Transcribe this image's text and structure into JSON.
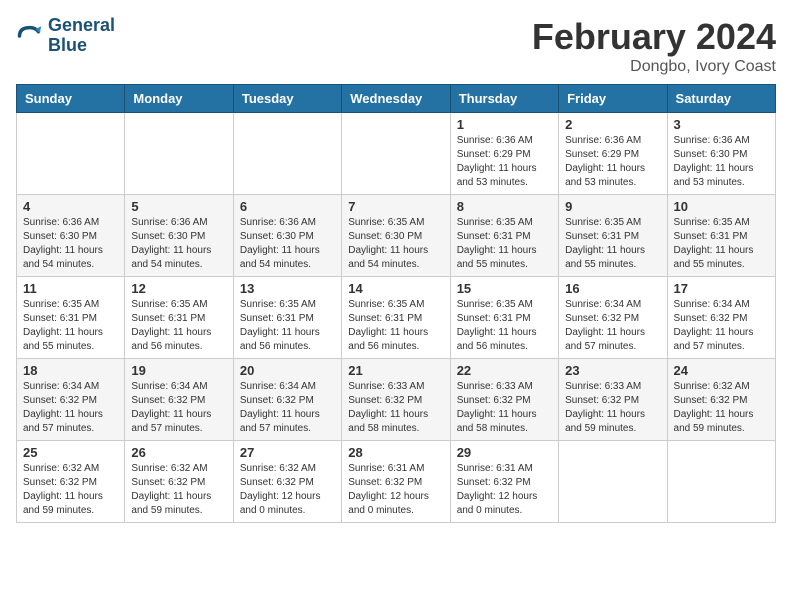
{
  "header": {
    "logo_line1": "General",
    "logo_line2": "Blue",
    "month": "February 2024",
    "location": "Dongbo, Ivory Coast"
  },
  "weekdays": [
    "Sunday",
    "Monday",
    "Tuesday",
    "Wednesday",
    "Thursday",
    "Friday",
    "Saturday"
  ],
  "weeks": [
    [
      {
        "day": "",
        "info": ""
      },
      {
        "day": "",
        "info": ""
      },
      {
        "day": "",
        "info": ""
      },
      {
        "day": "",
        "info": ""
      },
      {
        "day": "1",
        "info": "Sunrise: 6:36 AM\nSunset: 6:29 PM\nDaylight: 11 hours\nand 53 minutes."
      },
      {
        "day": "2",
        "info": "Sunrise: 6:36 AM\nSunset: 6:29 PM\nDaylight: 11 hours\nand 53 minutes."
      },
      {
        "day": "3",
        "info": "Sunrise: 6:36 AM\nSunset: 6:30 PM\nDaylight: 11 hours\nand 53 minutes."
      }
    ],
    [
      {
        "day": "4",
        "info": "Sunrise: 6:36 AM\nSunset: 6:30 PM\nDaylight: 11 hours\nand 54 minutes."
      },
      {
        "day": "5",
        "info": "Sunrise: 6:36 AM\nSunset: 6:30 PM\nDaylight: 11 hours\nand 54 minutes."
      },
      {
        "day": "6",
        "info": "Sunrise: 6:36 AM\nSunset: 6:30 PM\nDaylight: 11 hours\nand 54 minutes."
      },
      {
        "day": "7",
        "info": "Sunrise: 6:35 AM\nSunset: 6:30 PM\nDaylight: 11 hours\nand 54 minutes."
      },
      {
        "day": "8",
        "info": "Sunrise: 6:35 AM\nSunset: 6:31 PM\nDaylight: 11 hours\nand 55 minutes."
      },
      {
        "day": "9",
        "info": "Sunrise: 6:35 AM\nSunset: 6:31 PM\nDaylight: 11 hours\nand 55 minutes."
      },
      {
        "day": "10",
        "info": "Sunrise: 6:35 AM\nSunset: 6:31 PM\nDaylight: 11 hours\nand 55 minutes."
      }
    ],
    [
      {
        "day": "11",
        "info": "Sunrise: 6:35 AM\nSunset: 6:31 PM\nDaylight: 11 hours\nand 55 minutes."
      },
      {
        "day": "12",
        "info": "Sunrise: 6:35 AM\nSunset: 6:31 PM\nDaylight: 11 hours\nand 56 minutes."
      },
      {
        "day": "13",
        "info": "Sunrise: 6:35 AM\nSunset: 6:31 PM\nDaylight: 11 hours\nand 56 minutes."
      },
      {
        "day": "14",
        "info": "Sunrise: 6:35 AM\nSunset: 6:31 PM\nDaylight: 11 hours\nand 56 minutes."
      },
      {
        "day": "15",
        "info": "Sunrise: 6:35 AM\nSunset: 6:31 PM\nDaylight: 11 hours\nand 56 minutes."
      },
      {
        "day": "16",
        "info": "Sunrise: 6:34 AM\nSunset: 6:32 PM\nDaylight: 11 hours\nand 57 minutes."
      },
      {
        "day": "17",
        "info": "Sunrise: 6:34 AM\nSunset: 6:32 PM\nDaylight: 11 hours\nand 57 minutes."
      }
    ],
    [
      {
        "day": "18",
        "info": "Sunrise: 6:34 AM\nSunset: 6:32 PM\nDaylight: 11 hours\nand 57 minutes."
      },
      {
        "day": "19",
        "info": "Sunrise: 6:34 AM\nSunset: 6:32 PM\nDaylight: 11 hours\nand 57 minutes."
      },
      {
        "day": "20",
        "info": "Sunrise: 6:34 AM\nSunset: 6:32 PM\nDaylight: 11 hours\nand 57 minutes."
      },
      {
        "day": "21",
        "info": "Sunrise: 6:33 AM\nSunset: 6:32 PM\nDaylight: 11 hours\nand 58 minutes."
      },
      {
        "day": "22",
        "info": "Sunrise: 6:33 AM\nSunset: 6:32 PM\nDaylight: 11 hours\nand 58 minutes."
      },
      {
        "day": "23",
        "info": "Sunrise: 6:33 AM\nSunset: 6:32 PM\nDaylight: 11 hours\nand 59 minutes."
      },
      {
        "day": "24",
        "info": "Sunrise: 6:32 AM\nSunset: 6:32 PM\nDaylight: 11 hours\nand 59 minutes."
      }
    ],
    [
      {
        "day": "25",
        "info": "Sunrise: 6:32 AM\nSunset: 6:32 PM\nDaylight: 11 hours\nand 59 minutes."
      },
      {
        "day": "26",
        "info": "Sunrise: 6:32 AM\nSunset: 6:32 PM\nDaylight: 11 hours\nand 59 minutes."
      },
      {
        "day": "27",
        "info": "Sunrise: 6:32 AM\nSunset: 6:32 PM\nDaylight: 12 hours\nand 0 minutes."
      },
      {
        "day": "28",
        "info": "Sunrise: 6:31 AM\nSunset: 6:32 PM\nDaylight: 12 hours\nand 0 minutes."
      },
      {
        "day": "29",
        "info": "Sunrise: 6:31 AM\nSunset: 6:32 PM\nDaylight: 12 hours\nand 0 minutes."
      },
      {
        "day": "",
        "info": ""
      },
      {
        "day": "",
        "info": ""
      }
    ]
  ]
}
